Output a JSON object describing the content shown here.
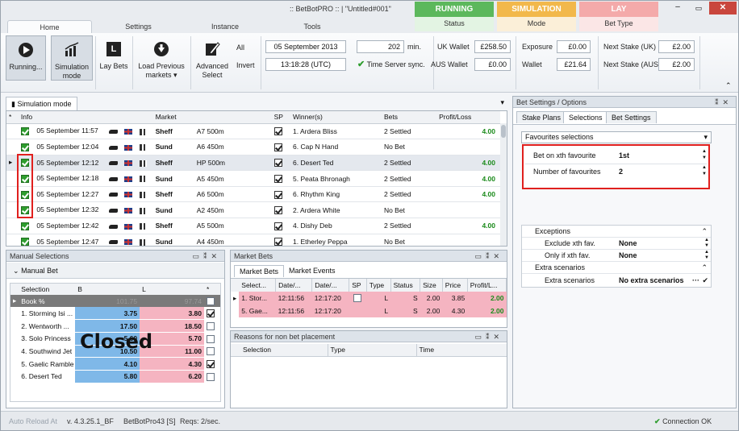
{
  "title": ":: BetBotPRO :: | \"Untitled#001\"",
  "tabs": {
    "home": "Home",
    "settings": "Settings",
    "instance": "Instance",
    "tools": "Tools"
  },
  "top_blocks": {
    "running": {
      "header": "RUNNING",
      "sub": "Status",
      "color": "#4caf50"
    },
    "simulation": {
      "header": "SIMULATION",
      "sub": "Mode",
      "color": "#f5b642"
    },
    "lay": {
      "header": "LAY",
      "sub": "Bet Type",
      "color": "#f4a3a3"
    }
  },
  "ribbon": {
    "running_label": "Running...",
    "sim_label_1": "Simulation",
    "sim_label_2": "mode",
    "lay_bets_label": "Lay Bets",
    "load_label_1": "Load Previous",
    "load_label_2": "markets",
    "adv_label_1": "Advanced",
    "adv_label_2": "Select",
    "all_label": "All",
    "invert_label": "Invert",
    "date": "05 September 2013",
    "time": "13:18:28 (UTC)",
    "minutes_value": "202",
    "minutes_unit": "min.",
    "time_sync": "Time Server sync.",
    "uk_wallet_label": "UK Wallet",
    "uk_wallet": "£258.50",
    "aus_wallet_label": "AUS Wallet",
    "aus_wallet": "£0.00",
    "exposure_label": "Exposure",
    "exposure": "£0.00",
    "wallet_label": "Wallet",
    "wallet": "£21.64",
    "next_uk_label": "Next Stake (UK)",
    "next_uk": "£2.00",
    "next_aus_label": "Next Stake (AUS)",
    "next_aus": "£2.00"
  },
  "sim_panel": {
    "title": "Simulation mode",
    "headers": [
      "*",
      "Info",
      "Market",
      "SP",
      "Winner(s)",
      "Bets",
      "Profit/Loss"
    ],
    "rows": [
      {
        "info": "05 September 11:57",
        "track": "Sheff",
        "market": "A7 500m",
        "winner": "1. Ardera Bliss",
        "bets": "2 Settled",
        "pl": "4.00"
      },
      {
        "info": "05 September 12:04",
        "track": "Sund",
        "market": "A6 450m",
        "winner": "6. Cap N Hand",
        "bets": "No Bet",
        "pl": ""
      },
      {
        "info": "05 September 12:12",
        "track": "Sheff",
        "market": "HP 500m",
        "winner": "6. Desert Ted",
        "bets": "2 Settled",
        "pl": "4.00"
      },
      {
        "info": "05 September 12:18",
        "track": "Sund",
        "market": "A5 450m",
        "winner": "5. Peata Bhronagh",
        "bets": "2 Settled",
        "pl": "4.00"
      },
      {
        "info": "05 September 12:27",
        "track": "Sheff",
        "market": "A6 500m",
        "winner": "6. Rhythm King",
        "bets": "2 Settled",
        "pl": "4.00"
      },
      {
        "info": "05 September 12:32",
        "track": "Sund",
        "market": "A2 450m",
        "winner": "2. Ardera White",
        "bets": "No Bet",
        "pl": ""
      },
      {
        "info": "05 September 12:42",
        "track": "Sheff",
        "market": "A5 500m",
        "winner": "4. Dishy Deb",
        "bets": "2 Settled",
        "pl": "4.00"
      },
      {
        "info": "05 September 12:47",
        "track": "Sund",
        "market": "A4 450m",
        "winner": "1. Etherley Peppa",
        "bets": "No Bet",
        "pl": ""
      }
    ]
  },
  "manual": {
    "title": "Manual Selections",
    "tab": "Manual Bet",
    "headers": [
      "Selection",
      "B",
      "L",
      "*"
    ],
    "book_label": "Book %",
    "book_b": "101.75",
    "book_l": "97.74",
    "rows": [
      {
        "sel": "1. Storming Isi ...",
        "b": "3.75",
        "l": "3.80",
        "chk": true
      },
      {
        "sel": "2. Wentworth ...",
        "b": "17.50",
        "l": "18.50",
        "chk": false
      },
      {
        "sel": "3. Solo Princess",
        "b": "5.60",
        "l": "5.70",
        "chk": false
      },
      {
        "sel": "4. Southwind Jet",
        "b": "10.50",
        "l": "11.00",
        "chk": false
      },
      {
        "sel": "5. Gaelic Ramble",
        "b": "4.10",
        "l": "4.30",
        "chk": true
      },
      {
        "sel": "6. Desert Ted",
        "b": "5.80",
        "l": "6.20",
        "chk": false
      }
    ],
    "overlay": "Closed"
  },
  "market_bets": {
    "title": "Market Bets",
    "tab_bets": "Market Bets",
    "tab_events": "Market Events",
    "headers": [
      "Select...",
      "Date/...",
      "Date/...",
      "SP",
      "Type",
      "Status",
      "Size",
      "Price",
      "Profit/L..."
    ],
    "rows": [
      {
        "sel": "1. Stor...",
        "d1": "12:11:56",
        "d2": "12:17:20",
        "type": "L",
        "status": "S",
        "size": "2.00",
        "price": "3.85",
        "pl": "2.00"
      },
      {
        "sel": "5. Gae...",
        "d1": "12:11:56",
        "d2": "12:17:20",
        "type": "L",
        "status": "S",
        "size": "2.00",
        "price": "4.30",
        "pl": "2.00"
      }
    ]
  },
  "reasons": {
    "title": "Reasons for non bet placement",
    "headers": [
      "Selection",
      "Type",
      "Time"
    ]
  },
  "bet_settings": {
    "title": "Bet Settings / Options",
    "tabs": [
      "Stake Plans",
      "Selections",
      "Bet Settings"
    ],
    "dropdown": "Favourites selections",
    "fields": [
      {
        "label": "Bet on xth favourite",
        "value": "1st"
      },
      {
        "label": "Number of favourites",
        "value": "2"
      }
    ],
    "exceptions_title": "Exceptions",
    "exceptions": [
      {
        "label": "Exclude xth fav.",
        "value": "None"
      },
      {
        "label": "Only if xth fav.",
        "value": "None"
      }
    ],
    "extra_title": "Extra scenarios",
    "extra": {
      "label": "Extra scenarios",
      "value": "No extra scenarios"
    }
  },
  "status": {
    "auto_reload": "Auto Reload At",
    "version": "v. 4.3.25.1_BF",
    "instance": "BetBotPro43 [S]",
    "reqs": "Reqs: 2/sec.",
    "connection": "Connection OK"
  }
}
